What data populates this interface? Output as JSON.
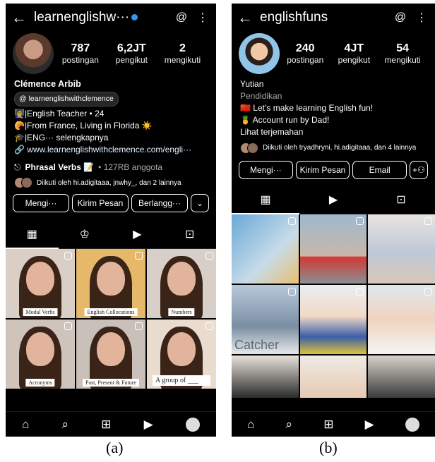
{
  "panel_a": {
    "topbar": {
      "back": "←",
      "username": "learnenglishw···",
      "icon_threads": "@",
      "icon_menu": "⋮"
    },
    "stats": [
      {
        "num": "787",
        "label": "postingan"
      },
      {
        "num": "6,2JT",
        "label": "pengikut"
      },
      {
        "num": "2",
        "label": "mengikuti"
      }
    ],
    "bio": {
      "name": "Clémence Arbib",
      "handle": "learnenglishwithclemence",
      "lines": [
        "👩‍🏫|English Teacher • 24",
        "🥐|From France, Living in Florida ☀️",
        "🎓|ENG··· selengkapnya"
      ],
      "link": "www.learnenglishwithclemence.com/engli···"
    },
    "channel": {
      "name": "Phrasal Verbs 📝",
      "members": "• 127RB anggota"
    },
    "followed_by": "Diikuti oleh hi.adigitaaa, jnwhy_, dan 2 lainnya",
    "buttons": [
      "Mengi···",
      "Kirim Pesan",
      "Berlangg···",
      "⌄"
    ],
    "tabs": [
      "▦",
      "♔",
      "▶",
      "⊡"
    ],
    "grid_captions": [
      "Modal Verbs",
      "English Collocations",
      "Numbers",
      "Acronyms",
      "Past, Present & Future",
      "A group of ___"
    ],
    "nav": [
      "⌂",
      "⌕",
      "⊞",
      "▶"
    ]
  },
  "panel_b": {
    "topbar": {
      "back": "←",
      "username": "englishfuns",
      "icon_threads": "@",
      "icon_menu": "⋮"
    },
    "stats": [
      {
        "num": "240",
        "label": "postingan"
      },
      {
        "num": "4JT",
        "label": "pengikut"
      },
      {
        "num": "54",
        "label": "mengikuti"
      }
    ],
    "bio": {
      "name": "Yutian",
      "category": "Pendidikan",
      "lines": [
        "🇨🇳 Let’s make learning English fun!",
        "🍍 Account run by Dad!"
      ],
      "translate": "Lihat terjemahan"
    },
    "followed_by": "Diikuti oleh tryadhryni, hi.adigitaaa, dan 4 lainnya",
    "buttons": [
      "Mengi···",
      "Kirim Pesan",
      "Email",
      "+⚇"
    ],
    "tabs": [
      "▦",
      "▶",
      "⊡"
    ],
    "grid_text": [
      "Catcher"
    ],
    "nav": [
      "⌂",
      "⌕",
      "⊞",
      "▶"
    ]
  },
  "labels": [
    "(a)",
    "(b)"
  ]
}
